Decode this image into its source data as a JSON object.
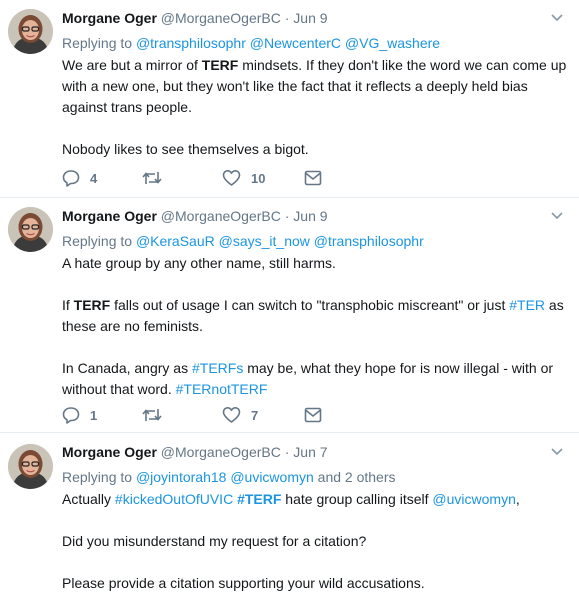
{
  "tweets": [
    {
      "name": "Morgane Oger",
      "handle": "@MorganeOgerBC",
      "time": "Jun 9",
      "replying_prefix": "Replying to",
      "replying_to": [
        "@transphilosophr",
        "@NewcenterC",
        "@VG_washere"
      ],
      "lines": [
        [
          "We are but a mirror of ",
          "TERF",
          " mindsets. If they don't like the word we can come up"
        ],
        [
          "with a new one, but they won't like the fact that it reflects a deeply held bias"
        ],
        [
          "against trans people."
        ],
        [
          "Nobody likes to see themselves a bigot."
        ]
      ],
      "replies": "4",
      "retweets": "",
      "likes": "10"
    },
    {
      "name": "Morgane Oger",
      "handle": "@MorganeOgerBC",
      "time": "Jun 9",
      "replying_prefix": "Replying to",
      "replying_to": [
        "@KeraSauR",
        "@says_it_now",
        "@transphilosophr"
      ],
      "lines": [
        [
          "A hate group by any other name, still harms."
        ],
        [
          "If  ",
          "TERF",
          " falls out of usage I can switch to \"transphobic miscreant\" or just ",
          "#TER",
          " as"
        ],
        [
          "these are no feminists."
        ],
        [
          "In Canada, angry as ",
          "#TERFs",
          " may be, what they hope for is now illegal - with or"
        ],
        [
          "without that word. ",
          "#TERnotTERF"
        ]
      ],
      "replies": "1",
      "retweets": "",
      "likes": "7"
    },
    {
      "name": "Morgane Oger",
      "handle": "@MorganeOgerBC",
      "time": "Jun 7",
      "replying_prefix": "Replying to",
      "replying_to": [
        "@joyintorah18",
        "@uvicwomyn"
      ],
      "replying_suffix": "and 2 others",
      "lines": [
        [
          "Actually ",
          "#kickedOutOfUVIC",
          " ",
          "#TERF",
          " hate group calling itself ",
          "@uvicwomyn",
          ","
        ],
        [
          "Did you misunderstand my request for a citation?"
        ],
        [
          "Please provide a citation supporting your wild accusations."
        ]
      ]
    }
  ]
}
